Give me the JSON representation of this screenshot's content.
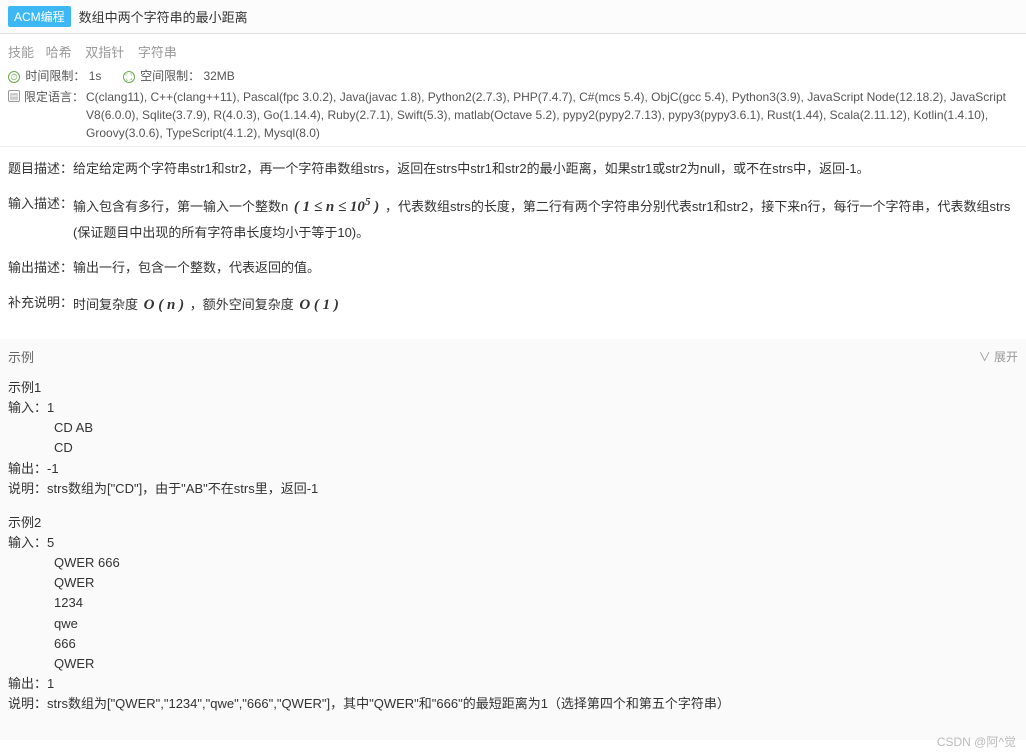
{
  "header": {
    "badge": "ACM编程",
    "title": "数组中两个字符串的最小距离"
  },
  "skills": {
    "label": "技能",
    "tags": [
      "哈希",
      "双指针",
      "字符串"
    ]
  },
  "limits": {
    "time_label": "时间限制：",
    "time_value": "1s",
    "space_label": "空间限制：",
    "space_value": "32MB"
  },
  "languages": {
    "label": "限定语言：",
    "list": "C(clang11), C++(clang++11), Pascal(fpc 3.0.2), Java(javac 1.8), Python2(2.7.3), PHP(7.4.7), C#(mcs 5.4), ObjC(gcc 5.4), Python3(3.9), JavaScript Node(12.18.2), JavaScript V8(6.0.0), Sqlite(3.7.9), R(4.0.3), Go(1.14.4), Ruby(2.7.1), Swift(5.3), matlab(Octave 5.2), pypy2(pypy2.7.13), pypy3(pypy3.6.1), Rust(1.44), Scala(2.11.12), Kotlin(1.4.10), Groovy(3.0.6), TypeScript(4.1.2), Mysql(8.0)"
  },
  "desc": {
    "problem_label": "题目描述：",
    "problem_text": "给定给定两个字符串str1和str2，再一个字符串数组strs，返回在strs中str1和str2的最小距离，如果str1或str2为null，或不在strs中，返回-1。",
    "input_label": "输入描述：",
    "input_pre": "输入包含有多行，第一输入一个整数n",
    "input_math": "( 1 ≤ n ≤ 10",
    "input_math_sup": "5",
    "input_math_end": " )",
    "input_post": "，代表数组strs的长度，第二行有两个字符串分别代表str1和str2，接下来n行，每行一个字符串，代表数组strs (保证题目中出现的所有字符串长度均小于等于10)。",
    "output_label": "输出描述：",
    "output_text": "输出一行，包含一个整数，代表返回的值。",
    "note_label": "补充说明：",
    "note_pre": "时间复杂度",
    "note_m1": "O ( n )",
    "note_mid": "，额外空间复杂度",
    "note_m2": "O ( 1 )"
  },
  "examples": {
    "head": "示例",
    "expand": "展开",
    "ex1": {
      "title": "示例1",
      "in_label": "输入：",
      "in_first": "1",
      "in_rest": [
        "CD AB",
        "CD"
      ],
      "out_label": "输出：",
      "out_val": "-1",
      "note_label": "说明：",
      "note_val": "strs数组为[\"CD\"]，由于\"AB\"不在strs里，返回-1"
    },
    "ex2": {
      "title": "示例2",
      "in_label": "输入：",
      "in_first": "5",
      "in_rest": [
        "QWER 666",
        "QWER",
        "1234",
        "qwe",
        "666",
        "QWER"
      ],
      "out_label": "输出：",
      "out_val": "1",
      "note_label": "说明：",
      "note_val": "strs数组为[\"QWER\",\"1234\",\"qwe\",\"666\",\"QWER\"]，其中\"QWER\"和\"666\"的最短距离为1（选择第四个和第五个字符串）"
    }
  },
  "watermark": "CSDN @阿^觉"
}
